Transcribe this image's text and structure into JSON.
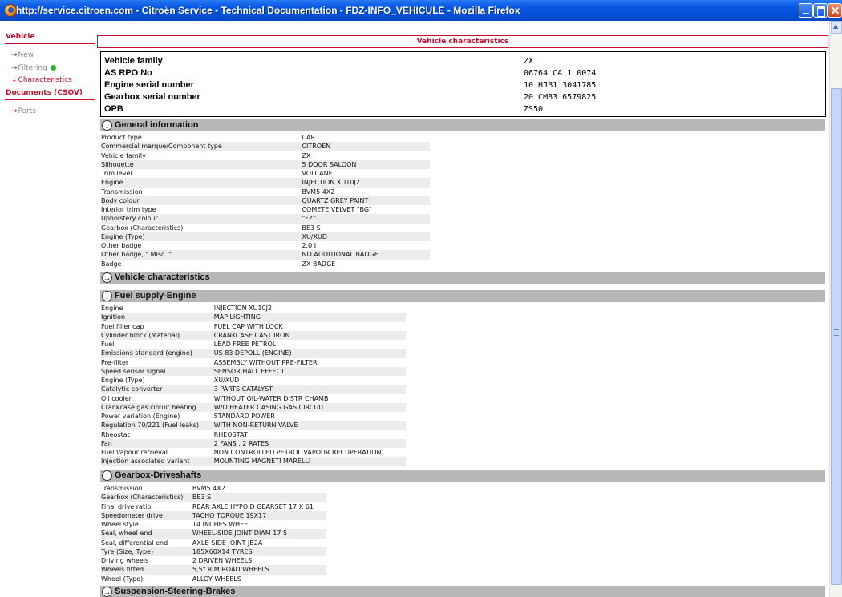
{
  "window": {
    "title": "http://service.citroen.com - Citroën Service - Technical Documentation - FDZ-INFO_VEHICULE - Mozilla Firefox"
  },
  "sidebar": {
    "vehicle_heading": "Vehicle",
    "vehicle_links": [
      {
        "label": "New"
      },
      {
        "label": "Filtering"
      },
      {
        "label": "Characteristics"
      }
    ],
    "documents_heading": "Documents (CSOV)",
    "document_links": [
      {
        "label": "Parts"
      }
    ]
  },
  "main": {
    "title": "Vehicle characteristics",
    "summary": [
      {
        "key": "Vehicle family",
        "value": "ZX"
      },
      {
        "key": "AS RPO No",
        "value": "06764 CA 1 0074"
      },
      {
        "key": "Engine serial number",
        "value": "10 HJB1 3041785"
      },
      {
        "key": "Gearbox serial number",
        "value": "20 CM83 6579825"
      },
      {
        "key": "OPB",
        "value": "ZS50"
      }
    ],
    "sections": [
      {
        "title": "General information",
        "rows": [
          [
            "Product type",
            "CAR"
          ],
          [
            "Commercial marque/Component type",
            "CITROEN"
          ],
          [
            "Vehicle family",
            "ZX"
          ],
          [
            "Silhouette",
            "5 DOOR SALOON"
          ],
          [
            "Trim level",
            "VOLCANE"
          ],
          [
            "Engine",
            "INJECTION XU10J2"
          ],
          [
            "Transmission",
            "BVM5 4X2"
          ],
          [
            "Body colour",
            "QUARTZ GREY PAINT"
          ],
          [
            "Interior trim type",
            "COMETE VELVET \"BG\""
          ],
          [
            "Upholstery colour",
            "\"FZ\""
          ],
          [
            "Gearbox (Characteristics)",
            "BE3 S"
          ],
          [
            "Engine (Type)",
            "XU/XUD"
          ],
          [
            "Other badge",
            "2,0 I"
          ],
          [
            "Other badge, \" Misc. \"",
            "NO ADDITIONAL BADGE"
          ],
          [
            "Badge",
            "ZX BADGE"
          ]
        ]
      },
      {
        "title": "Vehicle characteristics",
        "rows": []
      },
      {
        "title": "Fuel supply-Engine",
        "rows": [
          [
            "Engine",
            "INJECTION XU10J2"
          ],
          [
            "Ignition",
            "MAP LIGHTING"
          ],
          [
            "Fuel filler cap",
            "FUEL CAP WITH LOCK"
          ],
          [
            "Cylinder block (Material)",
            "CRANKCASE CAST IRON"
          ],
          [
            "Fuel",
            "LEAD FREE PETROL"
          ],
          [
            "Emissions standard (engine)",
            "US 83 DEPOLL (ENGINE)"
          ],
          [
            "Pre-filter",
            "ASSEMBLY WITHOUT PRE-FILTER"
          ],
          [
            "Speed sensor signal",
            "SENSOR HALL EFFECT"
          ],
          [
            "Engine (Type)",
            "XU/XUD"
          ],
          [
            "Catalytic converter",
            "3 PARTS CATALYST"
          ],
          [
            "Oil cooler",
            "WITHOUT OIL-WATER DISTR CHAMB"
          ],
          [
            "Crankcase gas circuit heating",
            "W/O HEATER CASING GAS CIRCUIT"
          ],
          [
            "Power variation (Engine)",
            "STANDARD POWER"
          ],
          [
            "Regulation 70/221 (Fuel leaks)",
            "WITH NON-RETURN VALVE"
          ],
          [
            "Rheostat",
            "RHEOSTAT"
          ],
          [
            "Fan",
            "2 FANS , 2 RATES"
          ],
          [
            "Fuel Vapour retrieval",
            "NON CONTROLLED PETROL VAPOUR RECUPERATION"
          ],
          [
            "Injection associated variant",
            "MOUNTING MAGNETI MARELLI"
          ]
        ]
      },
      {
        "title": "Gearbox-Driveshafts",
        "rows": [
          [
            "Transmission",
            "BVM5 4X2"
          ],
          [
            "Gearbox (Characteristics)",
            "BE3 S"
          ],
          [
            "Final drive ratio",
            "REAR AXLE HYPOID GEARSET 17 X 61"
          ],
          [
            "Speedometer drive",
            "TACHO TORQUE 19X17"
          ],
          [
            "Wheel style",
            "14 INCHES WHEEL"
          ],
          [
            "Seal, wheel end",
            "WHEEL-SIDE JOINT DIAM 17 5"
          ],
          [
            "Seal, differential end",
            "AXLE-SIDE JOINT JB2A"
          ],
          [
            "Tyre (Size, Type)",
            "185X60X14 TYRES"
          ],
          [
            "Driving wheels",
            "2 DRIVEN WHEELS"
          ],
          [
            "Wheels fitted",
            "5,5\" RIM ROAD WHEELS"
          ],
          [
            "Wheel (Type)",
            "ALLOY WHEELS"
          ]
        ]
      },
      {
        "title": "Suspension-Steering-Brakes",
        "rows": []
      }
    ]
  }
}
